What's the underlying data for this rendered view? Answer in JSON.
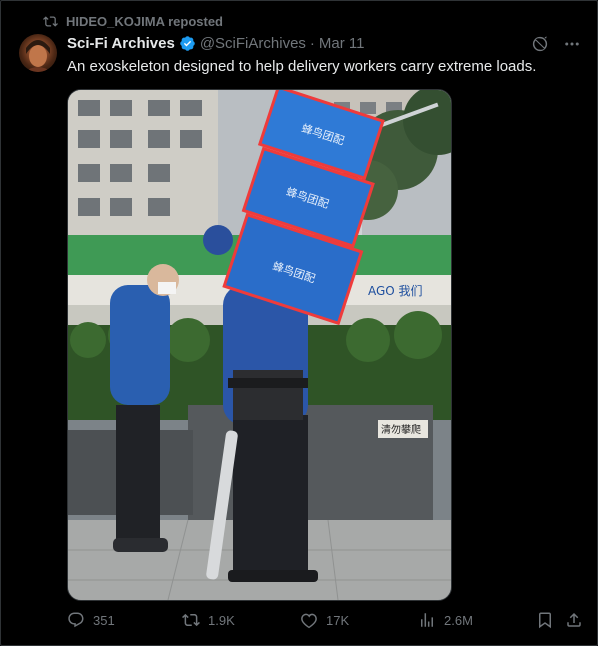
{
  "repost": {
    "text": "HIDEO_KOJIMA reposted",
    "icon": "repost-icon"
  },
  "author": {
    "name": "Sci-Fi Archives",
    "handle": "@SciFiArchives",
    "separator": "·",
    "date": "Mar 11",
    "verified_color": "#1d9bf0"
  },
  "tweet": {
    "text": "An exoskeleton designed to help delivery workers carry extreme loads."
  },
  "media": {
    "image_signs": [
      "清勿攀爬",
      "AGO 我们"
    ],
    "box_logos": [
      "蜂鸟团配",
      "蜂鸟团配",
      "蜂鸟团配"
    ]
  },
  "actions": {
    "replies": "351",
    "reposts": "1.9K",
    "likes": "17K",
    "views": "2.6M"
  },
  "colors": {
    "background": "#000000",
    "text": "#e7e9ea",
    "muted": "#71767b",
    "accent": "#1d9bf0"
  }
}
